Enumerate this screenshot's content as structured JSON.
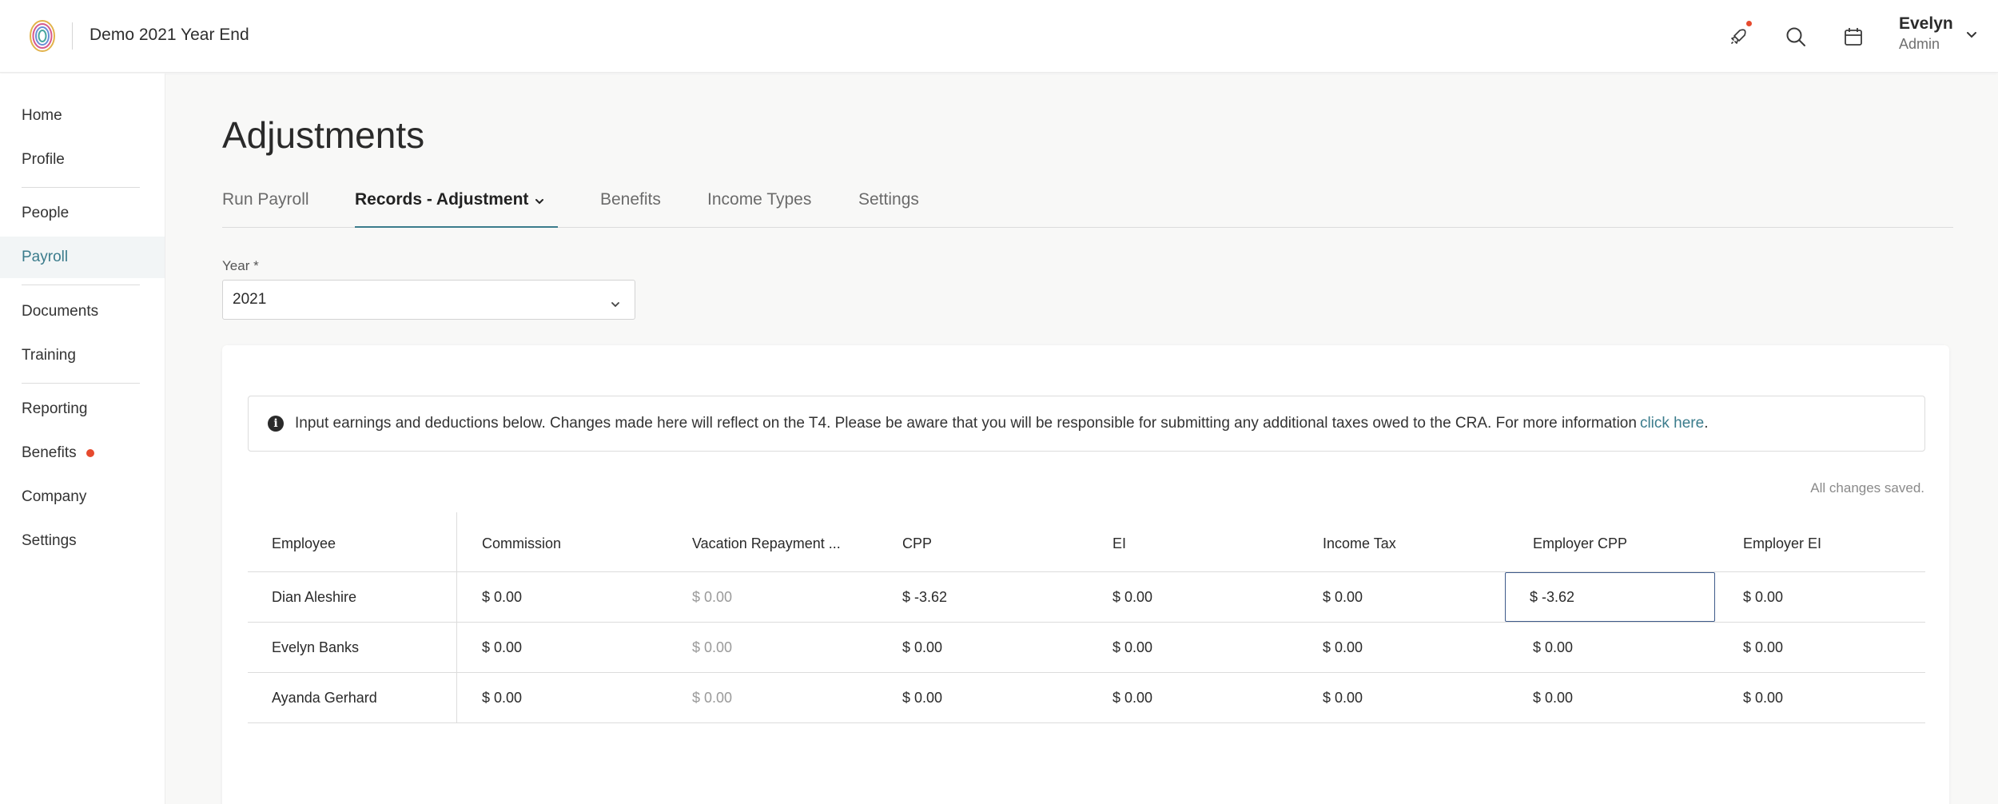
{
  "header": {
    "app_title": "Demo 2021 Year End",
    "user_name": "Evelyn",
    "user_role": "Admin",
    "icons": [
      "rocket-icon",
      "search-icon",
      "calendar-icon"
    ]
  },
  "sidebar": {
    "items": [
      {
        "label": "Home"
      },
      {
        "label": "Profile"
      },
      {
        "label": "People"
      },
      {
        "label": "Payroll",
        "active": true
      },
      {
        "label": "Documents"
      },
      {
        "label": "Training"
      },
      {
        "label": "Reporting"
      },
      {
        "label": "Benefits",
        "badge": true
      },
      {
        "label": "Company"
      },
      {
        "label": "Settings"
      }
    ]
  },
  "page": {
    "title": "Adjustments",
    "tabs": [
      {
        "label": "Run Payroll"
      },
      {
        "label": "Records - Adjustment",
        "active": true
      },
      {
        "label": "Benefits"
      },
      {
        "label": "Income Types"
      },
      {
        "label": "Settings"
      }
    ],
    "year_label": "Year *",
    "year_value": "2021"
  },
  "info": {
    "text": "Input earnings and deductions below. Changes made here will reflect on the T4. Please be aware that you will be responsible for submitting any additional taxes owed to the CRA. For more information",
    "link": "click here",
    "after": "."
  },
  "status": "All changes saved.",
  "table": {
    "columns": [
      "Employee",
      "Commission",
      "Vacation Repayment ...",
      "CPP",
      "EI",
      "Income Tax",
      "Employer CPP",
      "Employer EI"
    ],
    "rows": [
      {
        "employee": "Dian Aleshire",
        "values": [
          "$ 0.00",
          "$ 0.00",
          "$ -3.62",
          "$ 0.00",
          "$ 0.00",
          "$ -3.62",
          "$ 0.00"
        ]
      },
      {
        "employee": "Evelyn Banks",
        "values": [
          "$ 0.00",
          "$ 0.00",
          "$ 0.00",
          "$ 0.00",
          "$ 0.00",
          "$ 0.00",
          "$ 0.00"
        ]
      },
      {
        "employee": "Ayanda Gerhard",
        "values": [
          "$ 0.00",
          "$ 0.00",
          "$ 0.00",
          "$ 0.00",
          "$ 0.00",
          "$ 0.00",
          "$ 0.00"
        ]
      }
    ]
  },
  "colors": {
    "accent": "#3b7c8c",
    "notification": "#e64a2e",
    "focus_border": "#3e5a8a"
  }
}
